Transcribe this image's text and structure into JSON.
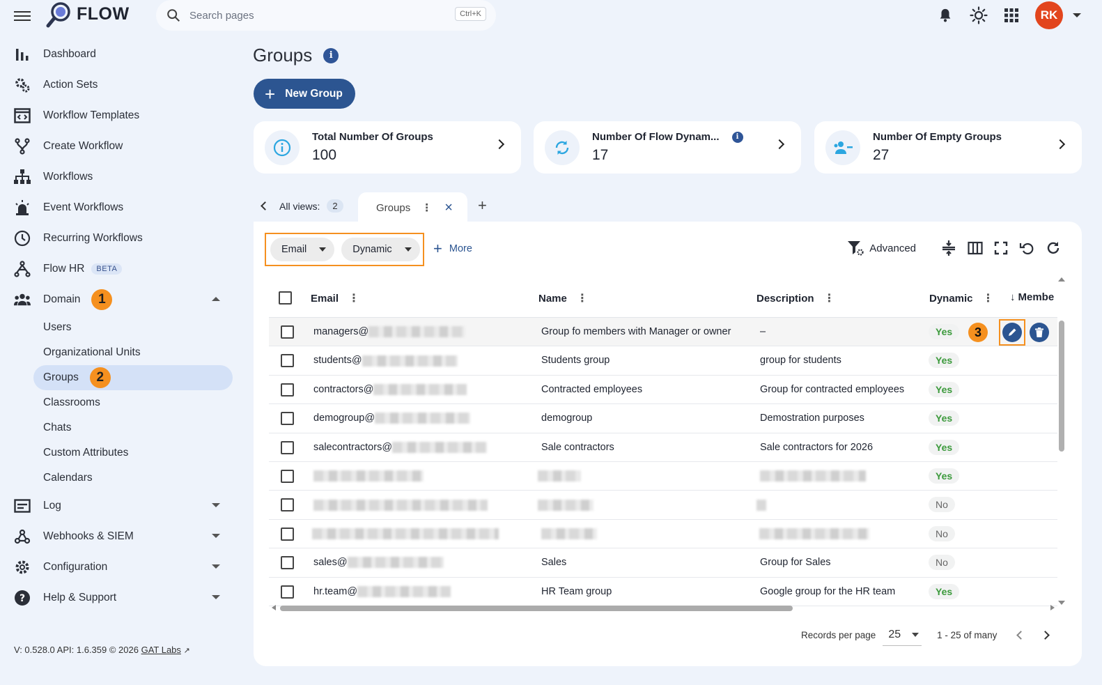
{
  "app": {
    "name": "FLOW"
  },
  "search": {
    "placeholder": "Search pages",
    "shortcut": "Ctrl+K"
  },
  "user": {
    "initials": "RK"
  },
  "sidebar": {
    "items": [
      {
        "label": "Dashboard",
        "icon": "bar-chart-icon"
      },
      {
        "label": "Action Sets",
        "icon": "gears-icon"
      },
      {
        "label": "Workflow Templates",
        "icon": "template-icon"
      },
      {
        "label": "Create Workflow",
        "icon": "branch-icon"
      },
      {
        "label": "Workflows",
        "icon": "sitemap-icon"
      },
      {
        "label": "Event Workflows",
        "icon": "alarm-icon"
      },
      {
        "label": "Recurring Workflows",
        "icon": "clock-icon"
      },
      {
        "label": "Flow HR",
        "icon": "hr-icon",
        "badge": "BETA"
      },
      {
        "label": "Domain",
        "icon": "people-icon",
        "marker": "1"
      }
    ],
    "domain_sub": [
      {
        "label": "Users"
      },
      {
        "label": "Organizational Units"
      },
      {
        "label": "Groups",
        "marker": "2"
      },
      {
        "label": "Classrooms"
      },
      {
        "label": "Chats"
      },
      {
        "label": "Custom Attributes"
      },
      {
        "label": "Calendars"
      }
    ],
    "bottom_items": [
      {
        "label": "Log",
        "icon": "log-icon"
      },
      {
        "label": "Webhooks & SIEM",
        "icon": "webhook-icon"
      },
      {
        "label": "Configuration",
        "icon": "gear-icon"
      },
      {
        "label": "Help & Support",
        "icon": "help-icon"
      }
    ],
    "version": "V: 0.528.0   API: 1.6.359   © 2026",
    "version_link": "GAT Labs"
  },
  "page": {
    "title": "Groups",
    "new_button": "New Group"
  },
  "stats": [
    {
      "label": "Total Number Of Groups",
      "value": "100"
    },
    {
      "label": "Number Of Flow Dynam...",
      "value": "17"
    },
    {
      "label": "Number Of Empty Groups",
      "value": "27"
    }
  ],
  "views": {
    "label": "All views:",
    "count": "2",
    "active_tab": "Groups"
  },
  "filters": {
    "chips": [
      "Email",
      "Dynamic"
    ],
    "more": "More",
    "advanced": "Advanced"
  },
  "table": {
    "columns": [
      "Email",
      "Name",
      "Description",
      "Dynamic",
      "Membe"
    ],
    "rows": [
      {
        "email": "managers@",
        "name": "Group fo members with Manager or owner",
        "description": "–",
        "dynamic": "Yes"
      },
      {
        "email": "students@",
        "name": "Students group",
        "description": "group for students",
        "dynamic": "Yes"
      },
      {
        "email": "contractors@",
        "name": "Contracted employees",
        "description": "Group for contracted employees",
        "dynamic": "Yes"
      },
      {
        "email": "demogroup@",
        "name": "demogroup",
        "description": "Demostration purposes",
        "dynamic": "Yes"
      },
      {
        "email": "salecontractors@",
        "name": "Sale contractors",
        "description": "Sale contractors for 2026",
        "dynamic": "Yes"
      },
      {
        "email": "",
        "name": "",
        "description": "",
        "dynamic": "Yes"
      },
      {
        "email": "",
        "name": "",
        "description": "",
        "dynamic": "No"
      },
      {
        "email": "",
        "name": "",
        "description": "",
        "dynamic": "No"
      },
      {
        "email": "sales@",
        "name": "Sales",
        "description": "Group for Sales",
        "dynamic": "No"
      },
      {
        "email": "hr.team@",
        "name": "HR Team group",
        "description": "Google group for the HR team",
        "dynamic": "Yes"
      }
    ],
    "row_marker": "3"
  },
  "pagination": {
    "label": "Records per page",
    "per_page": "25",
    "range": "1 - 25 of many"
  },
  "colors": {
    "accent": "#2c5591",
    "highlight": "#f5901f",
    "yes": "#3c9a3c",
    "avatar": "#e2451d"
  }
}
